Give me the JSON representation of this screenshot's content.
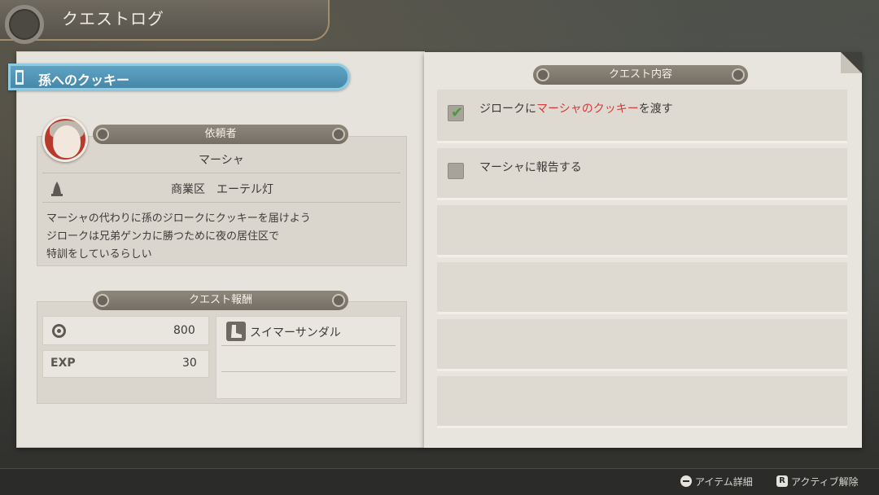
{
  "header": {
    "title": "クエストログ"
  },
  "quest": {
    "title": "孫へのクッキー"
  },
  "requester": {
    "heading": "依頼者",
    "name": "マーシャ",
    "location": "商業区　エーテル灯",
    "description": [
      "マーシャの代わりに孫のジロークにクッキーを届けよう",
      "ジロークは兄弟ゲンカに勝つために夜の居住区で",
      "特訓をしているらしい"
    ]
  },
  "rewards": {
    "heading": "クエスト報酬",
    "money_value": "800",
    "exp_label": "EXP",
    "exp_value": "30",
    "item": "スイマーサンダル"
  },
  "details": {
    "heading": "クエスト内容",
    "objectives": [
      {
        "before": "ジロークに",
        "highlight": "マーシャのクッキー",
        "after": "を渡す",
        "done": true
      },
      {
        "before": "マーシャに報告する",
        "highlight": "",
        "after": "",
        "done": false
      }
    ]
  },
  "footer": {
    "item_detail": "アイテム詳細",
    "active_cancel": "アクティブ解除",
    "r_key": "R"
  },
  "colors": {
    "accent_blue": "#4f93b6",
    "highlight_red": "#d63a3a",
    "check_green": "#4c9a3a"
  }
}
